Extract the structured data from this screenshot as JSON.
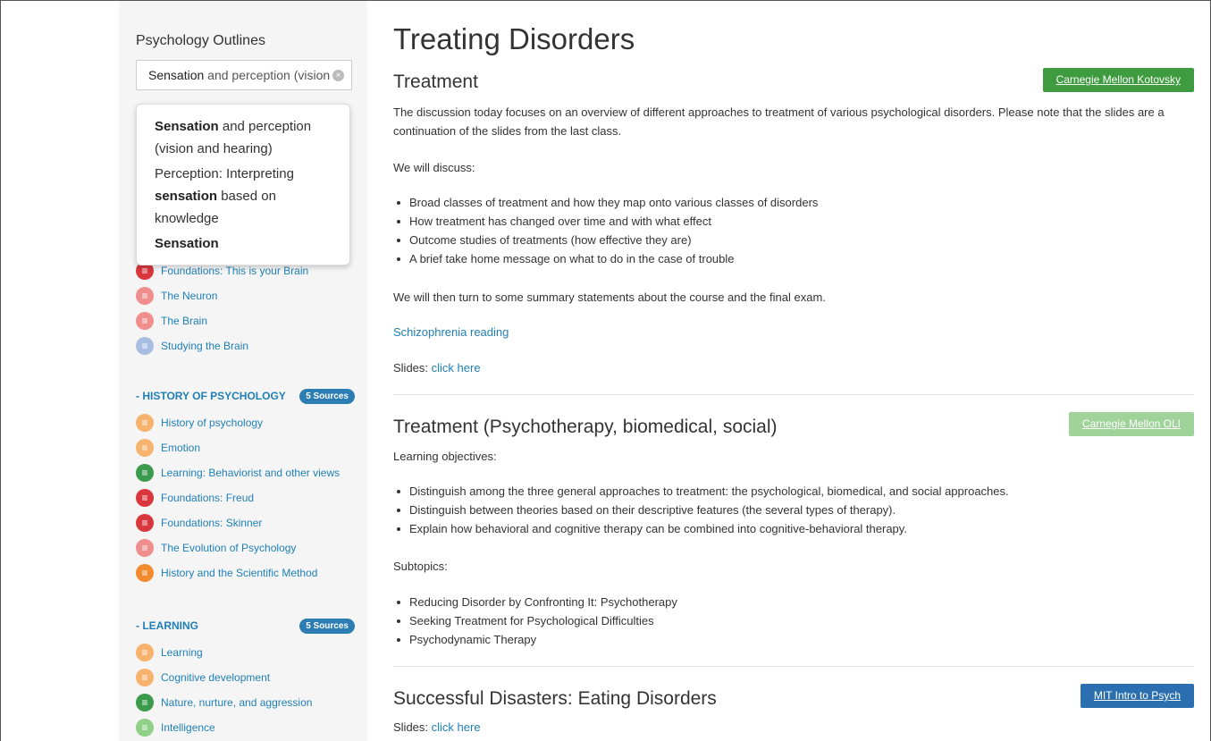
{
  "sidebar": {
    "title": "Psychology Outlines",
    "search": {
      "value_bold": "Sensation",
      "value_rest": " and perception (vision a"
    },
    "suggestions": [
      {
        "bold_pre": "Sensation",
        "rest": " and perception (vision and hearing)",
        "pre": ""
      },
      {
        "pre": "Perception: Interpreting ",
        "bold_pre": "sensation",
        "rest": " based on knowledge"
      },
      {
        "pre": "",
        "bold_pre": "Sensation",
        "rest": ""
      }
    ],
    "group1": [
      {
        "label": "Foundations: This is your Brain",
        "color": "#d9363e"
      },
      {
        "label": "The Neuron",
        "color": "#f08d8d"
      },
      {
        "label": "The Brain",
        "color": "#f08d8d"
      },
      {
        "label": "Studying the Brain",
        "color": "#a9bde3"
      }
    ],
    "history": {
      "title": "- HISTORY OF PSYCHOLOGY",
      "badge": "5 Sources",
      "items": [
        {
          "label": "History of psychology",
          "color": "#f7b26d"
        },
        {
          "label": "Emotion",
          "color": "#f7b26d"
        },
        {
          "label": "Learning: Behaviorist and other views",
          "color": "#3c9a4c"
        },
        {
          "label": "Foundations: Freud",
          "color": "#d9363e"
        },
        {
          "label": "Foundations: Skinner",
          "color": "#d9363e"
        },
        {
          "label": "The Evolution of Psychology",
          "color": "#f08d8d"
        },
        {
          "label": "History and the Scientific Method",
          "color": "#f28a2e"
        }
      ]
    },
    "learning": {
      "title": "- LEARNING",
      "badge": "5 Sources",
      "items": [
        {
          "label": "Learning",
          "color": "#f7b26d"
        },
        {
          "label": "Cognitive development",
          "color": "#f7b26d"
        },
        {
          "label": "Nature, nurture, and aggression",
          "color": "#3c9a4c"
        },
        {
          "label": "Intelligence",
          "color": "#8fcf86"
        }
      ]
    }
  },
  "main": {
    "title": "Treating Disorders",
    "s1": {
      "heading": "Treatment",
      "source": "Carnegie Mellon Kotovsky",
      "source_color": "#3f9b3f",
      "intro": "The discussion today focuses on an overview of different approaches to treatment of various psychological disorders. Please note that the slides are a continuation of the slides from the last class.",
      "discuss": "We will discuss:",
      "bullets": [
        "Broad classes of treatment and how they map onto various classes of disorders",
        "How treatment has changed over time and with what effect",
        "Outcome studies of treatments (how effective they are)",
        "A brief take home message on what to do in the case of trouble"
      ],
      "then": "We will then turn to some summary statements about the course and the final exam.",
      "reading": "Schizophrenia reading",
      "slides_label": "Slides: ",
      "slides_link": "click here"
    },
    "s2": {
      "heading": "Treatment (Psychotherapy, biomedical, social)",
      "source": "Carnegie Mellon OLI",
      "source_color": "#9fd39a",
      "objectives": "Learning objectives:",
      "bullets": [
        "Distinguish among the three general approaches to treatment: the psychological, biomedical, and social approaches.",
        "Distinguish between theories based on their descriptive features (the several types of therapy).",
        "Explain how behavioral and cognitive therapy can be combined into cognitive-behavioral therapy."
      ],
      "subtopics": "Subtopics:",
      "sub_bullets": [
        "Reducing Disorder by Confronting It: Psychotherapy",
        "Seeking Treatment for Psychological Difficulties",
        "Psychodynamic Therapy"
      ]
    },
    "s3": {
      "heading": "Successful Disasters: Eating Disorders",
      "source": "MIT Intro to Psych",
      "source_color": "#2b6fb0",
      "slides_label": "Slides: ",
      "slides_link": "click here"
    }
  }
}
